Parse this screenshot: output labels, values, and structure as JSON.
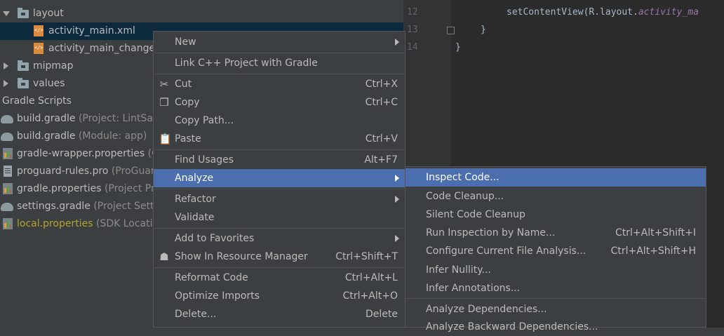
{
  "project_tree": {
    "items": [
      {
        "label": "layout",
        "hint": ""
      },
      {
        "label": "activity_main.xml",
        "hint": ""
      },
      {
        "label": "activity_main_change_",
        "hint": ""
      },
      {
        "label": "mipmap",
        "hint": ""
      },
      {
        "label": "values",
        "hint": ""
      },
      {
        "label": "Gradle Scripts",
        "hint": ""
      },
      {
        "label": "build.gradle",
        "hint": "(Project: LintSan"
      },
      {
        "label": "build.gradle",
        "hint": "(Module: app)"
      },
      {
        "label": "gradle-wrapper.properties",
        "hint": "(G"
      },
      {
        "label": "proguard-rules.pro",
        "hint": "(ProGuar"
      },
      {
        "label": "gradle.properties",
        "hint": "(Project Pro"
      },
      {
        "label": "settings.gradle",
        "hint": "(Project Settin"
      },
      {
        "label": "local.properties",
        "hint": "(SDK Locatio"
      }
    ]
  },
  "editor": {
    "line_numbers": [
      "12",
      "13",
      "14"
    ],
    "code": {
      "line1_prefix": "setContentView(R.layout.",
      "line1_italic": "activity_ma",
      "line2": "}",
      "line3": "}"
    }
  },
  "context_menu": {
    "items": [
      {
        "label": "New",
        "shortcut": ""
      },
      {
        "label": "Link C++ Project with Gradle",
        "shortcut": ""
      },
      {
        "label": "Cut",
        "shortcut": "Ctrl+X"
      },
      {
        "label": "Copy",
        "shortcut": "Ctrl+C"
      },
      {
        "label": "Copy Path...",
        "shortcut": ""
      },
      {
        "label": "Paste",
        "shortcut": "Ctrl+V"
      },
      {
        "label": "Find Usages",
        "shortcut": "Alt+F7"
      },
      {
        "label": "Analyze",
        "shortcut": ""
      },
      {
        "label": "Refactor",
        "shortcut": ""
      },
      {
        "label": "Validate",
        "shortcut": ""
      },
      {
        "label": "Add to Favorites",
        "shortcut": ""
      },
      {
        "label": "Show In Resource Manager",
        "shortcut": "Ctrl+Shift+T"
      },
      {
        "label": "Reformat Code",
        "shortcut": "Ctrl+Alt+L"
      },
      {
        "label": "Optimize Imports",
        "shortcut": "Ctrl+Alt+O"
      },
      {
        "label": "Delete...",
        "shortcut": "Delete"
      }
    ]
  },
  "analyze_submenu": {
    "items": [
      {
        "label": "Inspect Code...",
        "shortcut": ""
      },
      {
        "label": "Code Cleanup...",
        "shortcut": ""
      },
      {
        "label": "Silent Code Cleanup",
        "shortcut": ""
      },
      {
        "label": "Run Inspection by Name...",
        "shortcut": "Ctrl+Alt+Shift+I"
      },
      {
        "label": "Configure Current File Analysis...",
        "shortcut": "Ctrl+Alt+Shift+H"
      },
      {
        "label": "Infer Nullity...",
        "shortcut": ""
      },
      {
        "label": "Infer Annotations...",
        "shortcut": ""
      },
      {
        "label": "Analyze Dependencies...",
        "shortcut": ""
      },
      {
        "label": "Analyze Backward Dependencies...",
        "shortcut": ""
      }
    ]
  },
  "colors": {
    "highlight": "#4b6eaf",
    "panel_bg": "#3c3f41",
    "editor_bg": "#2b2b2b"
  }
}
